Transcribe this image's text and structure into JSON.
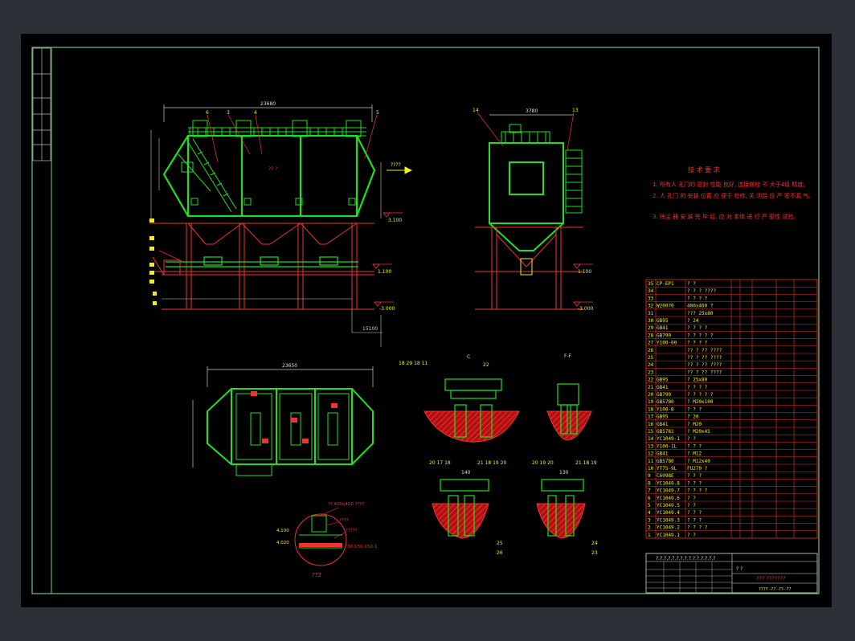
{
  "drawing": {
    "top_dims": {
      "overall_width": "23680",
      "right_width": "3780",
      "bottom_overall": "23650",
      "lower_dim": "15100"
    },
    "elevations": {
      "e1": "3.100",
      "e2": "1.100",
      "e3": "-3.000",
      "e4": "1.100",
      "e5": "-3.000"
    },
    "leader_labels": [
      "5",
      "6",
      "3",
      "4",
      "7",
      "8",
      "9",
      "10",
      "11",
      "12"
    ],
    "right_leaders": [
      "14",
      "13"
    ],
    "flow_label": "????",
    "mid_label": "?? ?",
    "section_labels": {
      "a": "C",
      "b": "F-F",
      "c": "F",
      "d": "F"
    },
    "detail_numbers": [
      "18",
      "29",
      "18",
      "11",
      "22",
      "20",
      "17",
      "18",
      "21",
      "18",
      "19",
      "20",
      "20",
      "19",
      "21",
      "18",
      "19",
      "25",
      "26",
      "24",
      "23"
    ],
    "detail_dims": {
      "d1": "140",
      "d2": "130"
    },
    "small_detail": {
      "label1": "?? 400x400 ????",
      "label2": "????",
      "label3": "?????",
      "label4": "30-150-150-1",
      "elev1": "4.100",
      "elev2": "4.020",
      "name": "??2"
    }
  },
  "notes": {
    "title": "技 术 要 求",
    "items": [
      "1. 所有人 孔门的 密封 性能 良好, 连接螺栓 不 大于4级 精度。",
      "2. 人 孔门 的 安装 位置 应 便于 检修, 关 闭后 应 严 密不漏 气。",
      "3. 除尘 器 安 装 完 毕 后, 应 对 本体 进 行 严 密性 试验。"
    ]
  },
  "bom": {
    "rows": [
      {
        "no": "35",
        "code": "CP-EP1",
        "name": "? ?"
      },
      {
        "no": "34",
        "code": "",
        "name": "? ? ? ????"
      },
      {
        "no": "33",
        "code": "",
        "name": "? ? ? ?"
      },
      {
        "no": "32",
        "code": "W20070",
        "name": "400x400 ?"
      },
      {
        "no": "31",
        "code": "",
        "name": "??? 25x80"
      },
      {
        "no": "30",
        "code": "GB95",
        "name": "? 24"
      },
      {
        "no": "29",
        "code": "GB41",
        "name": "? ? ? ?"
      },
      {
        "no": "28",
        "code": "GB799",
        "name": "? ? ? ? ?"
      },
      {
        "no": "27",
        "code": "Y100-00",
        "name": "? ? ? ?"
      },
      {
        "no": "26",
        "code": "",
        "name": "?? ? ?? ????"
      },
      {
        "no": "25",
        "code": "",
        "name": "?? ? ?? ????"
      },
      {
        "no": "24",
        "code": "",
        "name": "?? ? ?? ????"
      },
      {
        "no": "23",
        "code": "",
        "name": "?? ? ?? ????"
      },
      {
        "no": "22",
        "code": "GB95",
        "name": "? 25x80"
      },
      {
        "no": "21",
        "code": "GB41",
        "name": "? ? ? ?"
      },
      {
        "no": "20",
        "code": "GB799",
        "name": "? ? ? ? ?"
      },
      {
        "no": "19",
        "code": "GB5780",
        "name": "? M20x100"
      },
      {
        "no": "18",
        "code": "Y100-B",
        "name": "? ? ?"
      },
      {
        "no": "17",
        "code": "GB95",
        "name": "? 20"
      },
      {
        "no": "16",
        "code": "GB41",
        "name": "? M20"
      },
      {
        "no": "15",
        "code": "GB5781",
        "name": "? M20x45"
      },
      {
        "no": "14",
        "code": "YC1049-1",
        "name": "? ?"
      },
      {
        "no": "13",
        "code": "Y100-1L",
        "name": "? ? ?"
      },
      {
        "no": "12",
        "code": "GB41",
        "name": "? M12"
      },
      {
        "no": "11",
        "code": "GB5780",
        "name": "? M12x40"
      },
      {
        "no": "10",
        "code": "YT75-9L",
        "name": "FU270 ?"
      },
      {
        "no": "9",
        "code": "C6098E",
        "name": "? ? ?"
      },
      {
        "no": "8",
        "code": "YC1049.8",
        "name": "? ? ?"
      },
      {
        "no": "7",
        "code": "YC1049.7",
        "name": "? ? ? ?"
      },
      {
        "no": "6",
        "code": "YC1049.6",
        "name": "? ?"
      },
      {
        "no": "5",
        "code": "YC1049.5",
        "name": "? ?"
      },
      {
        "no": "4",
        "code": "YC1049.4",
        "name": "? ? ?"
      },
      {
        "no": "3",
        "code": "YC1049.3",
        "name": "? ? ?"
      },
      {
        "no": "2",
        "code": "YC1049.2",
        "name": "? ? ? ?"
      },
      {
        "no": "1",
        "code": "YC1049.1",
        "name": "? ?"
      }
    ]
  },
  "title_block": {
    "line1": "?.?.?.?.?.?.?.?.?.?.?.?.?.?.?",
    "line2": "? ?",
    "drawing_name": "??? ???????",
    "drawing_no": "???? -?? -??- ??"
  }
}
